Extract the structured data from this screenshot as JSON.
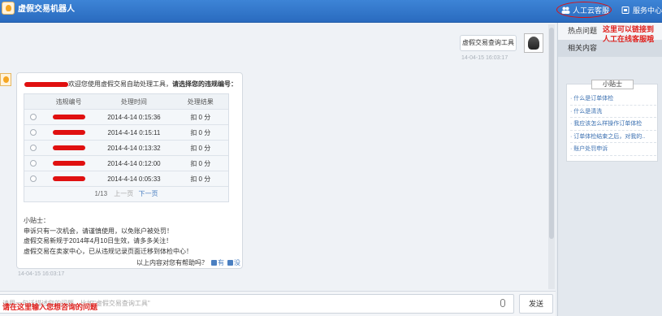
{
  "header": {
    "title": "虚假交易机器人",
    "agent_link": "人工云客服",
    "service_link": "服务中心"
  },
  "chat": {
    "user_message": "虚假交易查询工具",
    "user_timestamp": "14-04-15 16:03:17",
    "bot_intro_suffix": "欢迎您使用虚假交易自助处理工具，",
    "bot_intro_bold": "请选择您的违规编号：",
    "table": {
      "headers": [
        "违规编号",
        "处理时间",
        "处理结果"
      ],
      "rows": [
        {
          "time": "2014-4-14 0:15:36",
          "result": "扣 0 分"
        },
        {
          "time": "2014-4-14 0:15:11",
          "result": "扣 0 分"
        },
        {
          "time": "2014-4-14 0:13:32",
          "result": "扣 0 分"
        },
        {
          "time": "2014-4-14 0:12:00",
          "result": "扣 0 分"
        },
        {
          "time": "2014-4-14 0:05:33",
          "result": "扣 0 分"
        }
      ],
      "pager_info": "1/13",
      "prev_label": "上一页",
      "next_label": "下一页"
    },
    "tips": [
      "小贴士：",
      "申诉只有一次机会，请谨慎使用，以免账户被处罚！",
      "虚假交易新规于2014年4月10日生效，请多多关注！",
      "虚假交易在卖家中心，已从违规记录页面迁移到体检中心！"
    ],
    "feedback_question": "以上内容对您有帮助吗？",
    "feedback_yes": "有",
    "feedback_no": "没",
    "bot_timestamp": "14-04-15 16:03:17"
  },
  "input": {
    "placeholder": "请用一句话描述您的问题，比如\"虚假交易查询工具\"",
    "send_label": "发送"
  },
  "right_panel": {
    "tab_hot": "热点问题",
    "tab_related": "相关内容",
    "tips_title": "小贴士",
    "tips_items": [
      "什么是订单体检",
      "什么是清洗",
      "我应该怎么样操作订单体检",
      "订单体检结束之后，对我的..",
      "账户处罚申诉"
    ]
  },
  "annotations": {
    "agent_note": "这里可以链接到\n人工在线客服哦",
    "input_note": "请在这里输入您想咨询的问题"
  },
  "colors": {
    "header": "#2f74c8",
    "annotation": "#e0201c",
    "link": "#3a6fb0"
  }
}
